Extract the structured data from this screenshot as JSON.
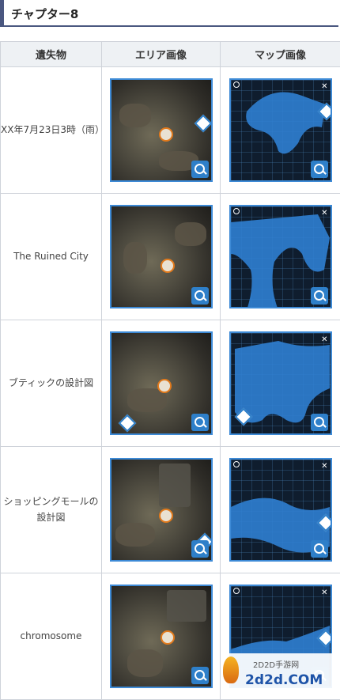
{
  "heading": "チャプター8",
  "table": {
    "headers": [
      "遺失物",
      "エリア画像",
      "マップ画像"
    ],
    "rows": [
      {
        "item": "XX年7月23日3時（雨）"
      },
      {
        "item": "The Ruined City"
      },
      {
        "item": "ブティックの設計図"
      },
      {
        "item": "ショッピングモールの設計図"
      },
      {
        "item": "chromosome"
      }
    ]
  },
  "watermark": {
    "small": "2D2D手游网",
    "big": "2d2d.COM"
  },
  "colors": {
    "heading_border": "#4a5780",
    "thumb_border": "#3d8ad6",
    "map_water": "#2f7fd1"
  }
}
